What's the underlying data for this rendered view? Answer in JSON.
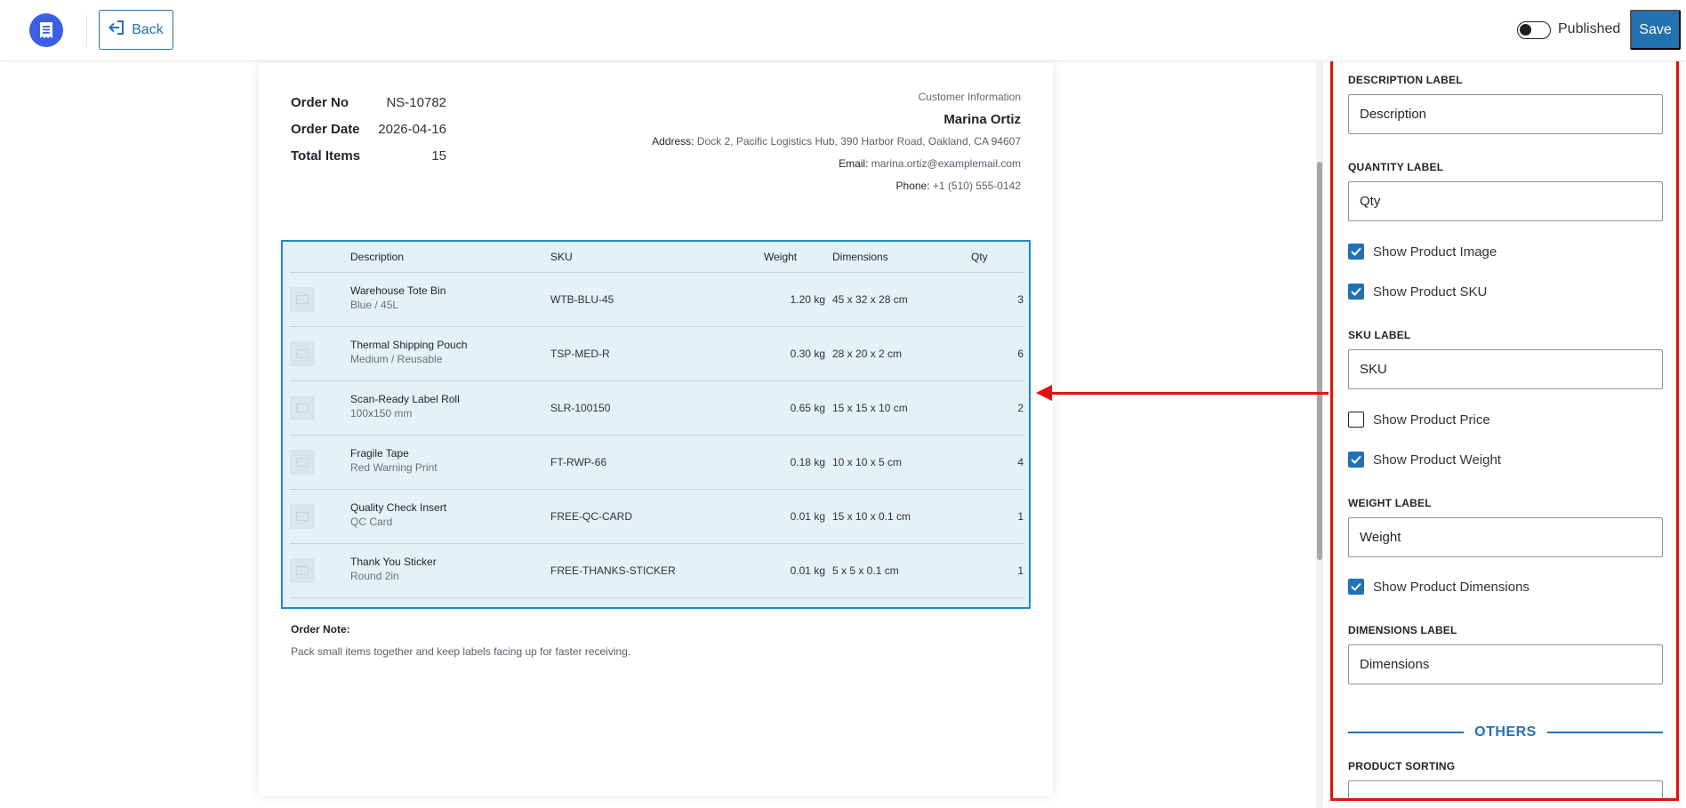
{
  "header": {
    "logo_icon": "receipt-icon",
    "back_label": "Back",
    "published_label": "Published",
    "save_label": "Save",
    "accent_color": "#2271b1"
  },
  "order": {
    "order_no_label": "Order No",
    "order_no": "NS-10782",
    "order_date_label": "Order Date",
    "order_date": "2026-04-16",
    "total_items_label": "Total Items",
    "total_items": "15"
  },
  "customer": {
    "section_title": "Customer Information",
    "name": "Marina Ortiz",
    "address_label": "Address:",
    "address": "Dock 2, Pacific Logistics Hub, 390 Harbor Road, Oakland, CA 94607",
    "email_label": "Email:",
    "email": "marina.ortiz@examplemail.com",
    "phone_label": "Phone:",
    "phone": "+1 (510) 555-0142"
  },
  "table": {
    "headers": {
      "description": "Description",
      "sku": "SKU",
      "weight": "Weight",
      "dimensions": "Dimensions",
      "qty": "Qty"
    },
    "rows": [
      {
        "name": "Warehouse Tote Bin",
        "variant": "Blue / 45L",
        "sku": "WTB-BLU-45",
        "weight": "1.20 kg",
        "dimensions": "45 x 32 x 28 cm",
        "qty": "3"
      },
      {
        "name": "Thermal Shipping Pouch",
        "variant": "Medium / Reusable",
        "sku": "TSP-MED-R",
        "weight": "0.30 kg",
        "dimensions": "28 x 20 x 2 cm",
        "qty": "6"
      },
      {
        "name": "Scan-Ready Label Roll",
        "variant": "100x150 mm",
        "sku": "SLR-100150",
        "weight": "0.65 kg",
        "dimensions": "15 x 15 x 10 cm",
        "qty": "2"
      },
      {
        "name": "Fragile Tape",
        "variant": "Red Warning Print",
        "sku": "FT-RWP-66",
        "weight": "0.18 kg",
        "dimensions": "10 x 10 x 5 cm",
        "qty": "4"
      },
      {
        "name": "Quality Check Insert",
        "variant": "QC Card",
        "sku": "FREE-QC-CARD",
        "weight": "0.01 kg",
        "dimensions": "15 x 10 x 0.1 cm",
        "qty": "1"
      },
      {
        "name": "Thank You Sticker",
        "variant": "Round 2in",
        "sku": "FREE-THANKS-STICKER",
        "weight": "0.01 kg",
        "dimensions": "5 x 5 x 0.1 cm",
        "qty": "1"
      }
    ]
  },
  "note": {
    "title": "Order Note:",
    "body": "Pack small items together and keep labels facing up for faster receiving."
  },
  "settings": {
    "description_label_title": "Description Label",
    "description_label_value": "Description",
    "quantity_label_title": "Quantity Label",
    "quantity_label_value": "Qty",
    "show_product_image": {
      "label": "Show Product Image",
      "checked": true
    },
    "show_product_sku": {
      "label": "Show Product SKU",
      "checked": true
    },
    "sku_label_title": "SKU Label",
    "sku_label_value": "SKU",
    "show_product_price": {
      "label": "Show Product Price",
      "checked": false
    },
    "show_product_weight": {
      "label": "Show Product Weight",
      "checked": true
    },
    "weight_label_title": "Weight Label",
    "weight_label_value": "Weight",
    "show_product_dimensions": {
      "label": "Show Product Dimensions",
      "checked": true
    },
    "dimensions_label_title": "Dimensions Label",
    "dimensions_label_value": "Dimensions",
    "others_heading": "OTHERS",
    "product_sorting_title": "Product Sorting"
  }
}
